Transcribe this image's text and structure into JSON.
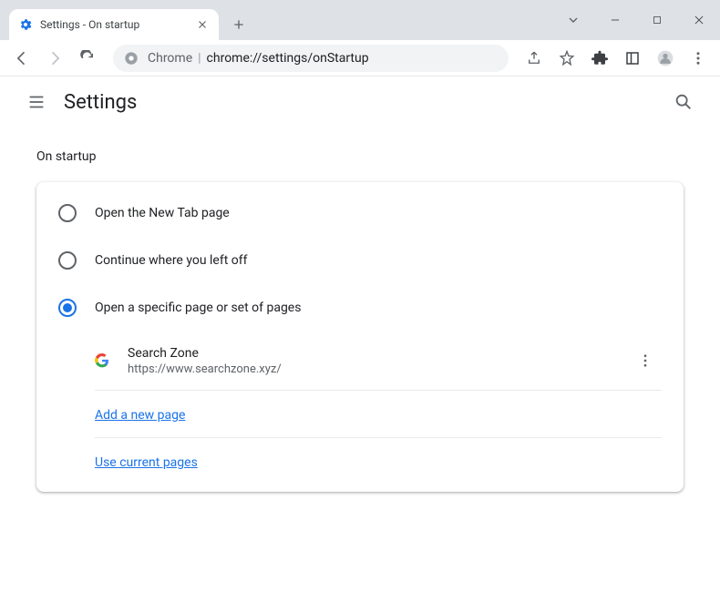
{
  "tab": {
    "title": "Settings - On startup"
  },
  "omnibox": {
    "prefix": "Chrome",
    "url": "chrome://settings/onStartup"
  },
  "header": {
    "title": "Settings"
  },
  "section": {
    "title": "On startup"
  },
  "radios": {
    "newtab": "Open the New Tab page",
    "continue": "Continue where you left off",
    "specific": "Open a specific page or set of pages"
  },
  "page": {
    "name": "Search Zone",
    "url": "https://www.searchzone.xyz/"
  },
  "links": {
    "add": "Add a new page",
    "use_current": "Use current pages"
  }
}
